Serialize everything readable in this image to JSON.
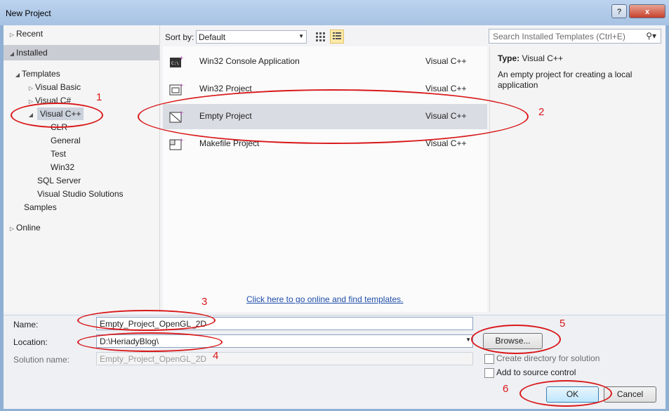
{
  "window": {
    "title": "New Project",
    "help": "?",
    "close": "x"
  },
  "left_tree": {
    "recent": "Recent",
    "installed": "Installed",
    "templates": "Templates",
    "visual_basic": "Visual Basic",
    "visual_csharp": "Visual C#",
    "visual_cpp": "Visual C++",
    "clr": "CLR",
    "general": "General",
    "test": "Test",
    "win32": "Win32",
    "sql_server": "SQL Server",
    "vs_solutions": "Visual Studio Solutions",
    "samples": "Samples",
    "online": "Online"
  },
  "toolbar": {
    "sort_label": "Sort by:",
    "sort_value": "Default",
    "search_placeholder": "Search Installed Templates (Ctrl+E)"
  },
  "templates": [
    {
      "name": "Win32 Console Application",
      "lang": "Visual C++"
    },
    {
      "name": "Win32 Project",
      "lang": "Visual C++"
    },
    {
      "name": "Empty Project",
      "lang": "Visual C++"
    },
    {
      "name": "Makefile Project",
      "lang": "Visual C++"
    }
  ],
  "online_link": "Click here to go online and find templates.",
  "details": {
    "type_label": "Type:",
    "type_value": "Visual C++",
    "description": "An empty project for creating a local application"
  },
  "form": {
    "name_label": "Name:",
    "name_value": "Empty_Project_OpenGL_2D",
    "location_label": "Location:",
    "location_value": "D:\\HeriadyBlog\\",
    "solution_label": "Solution name:",
    "solution_value": "Empty_Project_OpenGL_2D",
    "browse": "Browse...",
    "create_dir": "Create directory for solution",
    "add_source": "Add to source control",
    "ok": "OK",
    "cancel": "Cancel"
  },
  "annotations": {
    "n1": "1",
    "n2": "2",
    "n3": "3",
    "n4": "4",
    "n5": "5",
    "n6": "6",
    "color": "#d9181a"
  },
  "icons": {
    "help": "help-icon",
    "close": "close-icon",
    "search": "search-icon",
    "grid": "grid-view-icon",
    "list": "list-view-icon"
  }
}
